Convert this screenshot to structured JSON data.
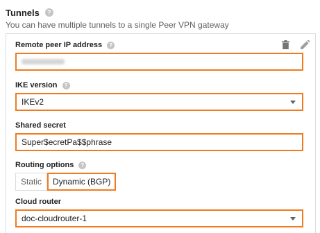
{
  "header": {
    "title": "Tunnels",
    "subtitle": "You can have multiple tunnels to a single Peer VPN gateway"
  },
  "icons": {
    "help": "help-circle-icon",
    "delete": "trash-icon",
    "edit": "pencil-icon",
    "dropdown": "chevron-down-icon"
  },
  "colors": {
    "highlight": "#f07b1f",
    "help_icon": "#c4c4c4",
    "border": "#dcdcdc"
  },
  "fields": {
    "remote_ip": {
      "label": "Remote peer IP address",
      "value": ""
    },
    "ike_version": {
      "label": "IKE version",
      "value": "IKEv2"
    },
    "shared_secret": {
      "label": "Shared secret",
      "value": "Super$ecretPa$$phrase"
    },
    "routing": {
      "label": "Routing options",
      "options": [
        "Static",
        "Dynamic (BGP)"
      ],
      "selected": "Dynamic (BGP)"
    },
    "cloud_router": {
      "label": "Cloud router",
      "value": "doc-cloudrouter-1"
    }
  }
}
